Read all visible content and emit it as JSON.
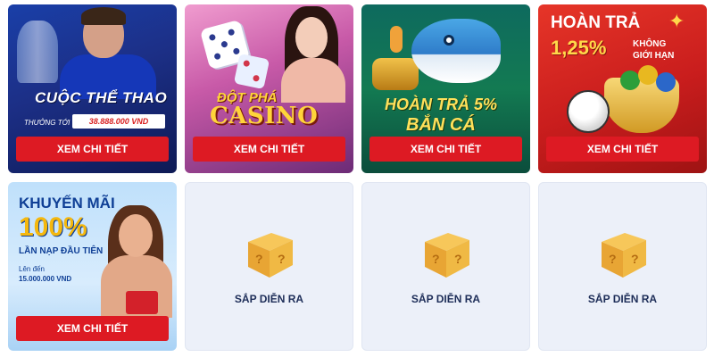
{
  "cards": [
    {
      "id": "sports",
      "headline": "CUỘC THỂ THAO",
      "sub_label": "THƯỞNG TỚI",
      "amount": "38.888.000 VND",
      "button": "XEM CHI TIẾT"
    },
    {
      "id": "casino",
      "headline_top": "ĐỘT PHÁ",
      "headline_main": "CASINO",
      "button": "XEM CHI TIẾT"
    },
    {
      "id": "fishing",
      "headline_top": "HOÀN TRẢ 5%",
      "headline_main": "BẮN CÁ",
      "button": "XEM CHI TIẾT"
    },
    {
      "id": "refund",
      "title": "HOÀN TRẢ",
      "percent": "1,25%",
      "note_line1": "KHÔNG",
      "note_line2": "GIỚI HẠN",
      "button": "XEM CHI TIẾT"
    },
    {
      "id": "deposit-promo",
      "title": "KHUYẾN MÃI",
      "percent": "100%",
      "sub": "LẦN NẠP ĐẦU TIÊN",
      "up_to": "Lên đến",
      "amount": "15.000.000 VND",
      "button": "XEM CHI TIẾT"
    }
  ],
  "coming_soon": [
    {
      "label": "SẮP DIỄN RA"
    },
    {
      "label": "SẮP DIỄN RA"
    },
    {
      "label": "SẮP DIỄN RA"
    }
  ],
  "colors": {
    "button_red": "#dd1a23",
    "placeholder_bg": "#ecf0f9",
    "label_navy": "#1d2d58"
  },
  "icons": [
    "trophy-icon",
    "dice-icon",
    "shark-icon",
    "star-icon",
    "soccer-ball-icon",
    "trophy-cup-icon",
    "gift-icon",
    "mystery-box-icon"
  ]
}
